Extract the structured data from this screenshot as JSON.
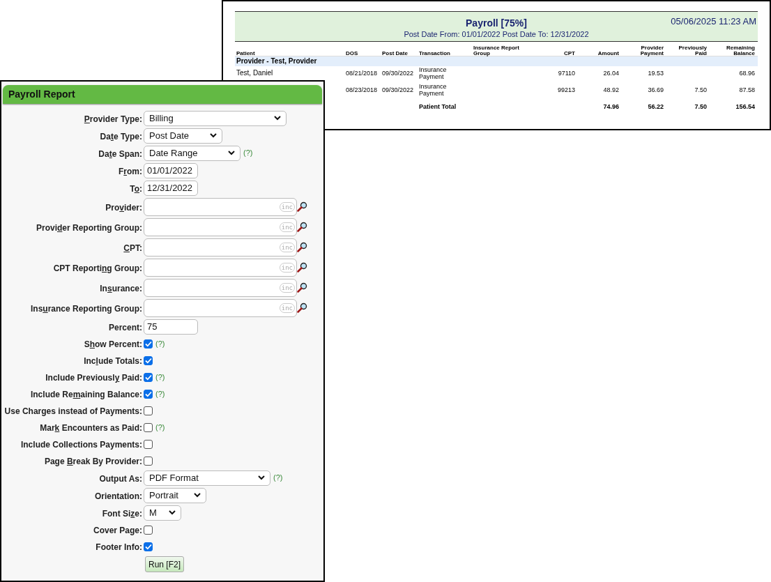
{
  "report_preview": {
    "title": "Payroll [75%]",
    "timestamp": "05/06/2025 11:23 AM",
    "subtitle": "Post Date From: 01/01/2022 Post Date To: 12/31/2022",
    "columns": [
      "Patient",
      "DOS",
      "Post Date",
      "Transaction",
      "Insurance Report Group",
      "CPT",
      "Amount",
      "Provider Payment",
      "Previously Paid",
      "Remaining Balance"
    ],
    "group": "Provider - Test, Provider",
    "rows": [
      {
        "kind": "detail",
        "cells": [
          "Test, Daniel",
          "08/21/2018",
          "09/30/2022",
          "Insurance Payment",
          null,
          "97110",
          "26.04",
          "19.53",
          null,
          "68.96"
        ]
      },
      {
        "kind": "detail",
        "cells": [
          null,
          "08/23/2018",
          "09/30/2022",
          "Insurance Payment",
          null,
          "99213",
          "48.92",
          "36.69",
          "7.50",
          "87.58"
        ]
      },
      {
        "kind": "total",
        "cells": [
          null,
          null,
          null,
          "Patient Total",
          null,
          null,
          "74.96",
          "56.22",
          "7.50",
          "156.54"
        ]
      }
    ]
  },
  "form": {
    "title": "Payroll Report",
    "fields": [
      {
        "kind": "select",
        "label": {
          "key": "P",
          "after": "rovider Type:"
        },
        "value": "Billing",
        "help": false
      },
      {
        "kind": "select",
        "label": {
          "before": "Da",
          "key": "t",
          "after": "e Type:"
        },
        "value": "Post Date",
        "help": false
      },
      {
        "kind": "select",
        "label": {
          "before": "Da",
          "key": "t",
          "after": "e Span:"
        },
        "value": "Date Range",
        "help": true
      },
      {
        "kind": "text",
        "label": {
          "before": "F",
          "key": "r",
          "after": "om:"
        },
        "value": "01/01/2022"
      },
      {
        "kind": "text",
        "label": {
          "before": "T",
          "key": "o",
          "after": ":"
        },
        "value": "12/31/2022"
      },
      {
        "kind": "lookup",
        "label": {
          "before": "Pro",
          "key": "v",
          "after": "ider:"
        },
        "badge": "inc"
      },
      {
        "kind": "lookup",
        "label": {
          "before": "Provi",
          "key": "d",
          "after": "er Reporting Group:"
        },
        "badge": "inc"
      },
      {
        "kind": "lookup",
        "label": {
          "key": "C",
          "after": "PT:"
        },
        "badge": "inc"
      },
      {
        "kind": "lookup",
        "label": {
          "before": "CPT Reporti",
          "key": "n",
          "after": "g Group:"
        },
        "badge": "inc"
      },
      {
        "kind": "lookup",
        "label": {
          "before": "In",
          "key": "s",
          "after": "urance:"
        },
        "badge": "inc"
      },
      {
        "kind": "lookup",
        "label": {
          "before": "Ins",
          "key": "u",
          "after": "rance Reporting Group:"
        },
        "badge": "inc"
      },
      {
        "kind": "text",
        "label": {
          "before": "Percent:"
        },
        "value": "75"
      },
      {
        "kind": "checkbox",
        "label": {
          "before": "S",
          "key": "h",
          "after": "ow Percent:"
        },
        "checked": true,
        "help": true
      },
      {
        "kind": "checkbox",
        "label": {
          "before": "Inc",
          "key": "l",
          "after": "ude Totals:"
        },
        "checked": true,
        "help": false
      },
      {
        "kind": "checkbox",
        "label": {
          "before": "Include Previousl",
          "key": "y",
          "after": " Paid:"
        },
        "checked": true,
        "help": true
      },
      {
        "kind": "checkbox",
        "label": {
          "before": "Include Re",
          "key": "m",
          "after": "aining Balance:"
        },
        "checked": true,
        "help": true
      },
      {
        "kind": "checkbox",
        "label": {
          "before": "Use Charges instead of Payments:"
        },
        "checked": false,
        "help": false
      },
      {
        "kind": "checkbox",
        "label": {
          "before": "Mar",
          "key": "k",
          "after": " Encounters as Paid:"
        },
        "checked": false,
        "help": true
      },
      {
        "kind": "checkbox",
        "label": {
          "before": "Include Collections Payments:"
        },
        "checked": false,
        "help": false
      },
      {
        "kind": "checkbox",
        "label": {
          "before": "Page ",
          "key": "B",
          "after": "reak By Provider:"
        },
        "checked": false,
        "help": false
      },
      {
        "kind": "select",
        "label": {
          "before": "Output As:"
        },
        "value": "PDF Format",
        "help": true
      },
      {
        "kind": "select",
        "label": {
          "before": "Orientation:"
        },
        "value": "Portrait",
        "help": false
      },
      {
        "kind": "select",
        "label": {
          "before": "Font Si",
          "key": "z",
          "after": "e:"
        },
        "value": "M",
        "help": false
      },
      {
        "kind": "checkbox",
        "label": {
          "before": "Cover Page:"
        },
        "checked": false,
        "help": false
      },
      {
        "kind": "checkbox",
        "label": {
          "before": "Footer Info:"
        },
        "checked": true,
        "help": false
      }
    ],
    "help_text": "(?)",
    "run_button": "Run [F2]"
  }
}
